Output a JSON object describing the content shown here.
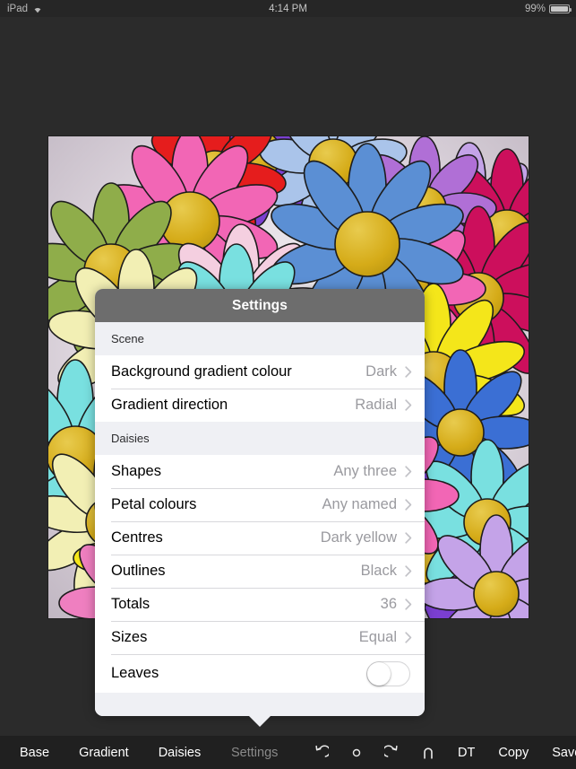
{
  "statusbar": {
    "device": "iPad",
    "wifi_icon": "wifi-icon",
    "time": "4:14 PM",
    "battery_percent": "99%",
    "battery_icon": "battery-icon"
  },
  "popover": {
    "title": "Settings",
    "sections": [
      {
        "header": "Scene",
        "rows": [
          {
            "label": "Background gradient colour",
            "value": "Dark",
            "type": "disclosure"
          },
          {
            "label": "Gradient direction",
            "value": "Radial",
            "type": "disclosure"
          }
        ]
      },
      {
        "header": "Daisies",
        "rows": [
          {
            "label": "Shapes",
            "value": "Any three",
            "type": "disclosure"
          },
          {
            "label": "Petal colours",
            "value": "Any named",
            "type": "disclosure"
          },
          {
            "label": "Centres",
            "value": "Dark yellow",
            "type": "disclosure"
          },
          {
            "label": "Outlines",
            "value": "Black",
            "type": "disclosure"
          },
          {
            "label": "Totals",
            "value": "36",
            "type": "disclosure"
          },
          {
            "label": "Sizes",
            "value": "Equal",
            "type": "disclosure"
          },
          {
            "label": "Leaves",
            "value": "off",
            "type": "switch"
          }
        ]
      }
    ]
  },
  "toolbar": {
    "left_items": [
      {
        "label": "Base",
        "active": false
      },
      {
        "label": "Gradient",
        "active": false
      },
      {
        "label": "Daisies",
        "active": false
      }
    ],
    "settings_label": "Settings",
    "settings_active": true,
    "right_items": [
      {
        "label": "",
        "icon": "undo-icon"
      },
      {
        "label": "",
        "icon": "circle-icon"
      },
      {
        "label": "",
        "icon": "redo-icon"
      },
      {
        "label": "",
        "icon": "magnet-icon"
      },
      {
        "label": "DT",
        "icon": ""
      },
      {
        "label": "Copy",
        "icon": ""
      },
      {
        "label": "Save",
        "icon": ""
      },
      {
        "label": "?",
        "icon": ""
      }
    ]
  },
  "canvas": {
    "title": "daisies-artwork",
    "background_gradient": "Dark / Radial",
    "colors": {
      "accent_gold": "#d6ae20",
      "pink": "#f266b5",
      "blue": "#5b8fd4",
      "crimson": "#cc0f5c",
      "cyan": "#79e0e0",
      "yellow": "#f4e61a",
      "olive": "#8fad4a",
      "cream": "#f2efb4",
      "violet": "#7b3fd1",
      "lilac": "#c4a3e8",
      "lightpink": "#f4cfe0",
      "red": "#e51d1d",
      "lightblue": "#aac4ea"
    }
  }
}
